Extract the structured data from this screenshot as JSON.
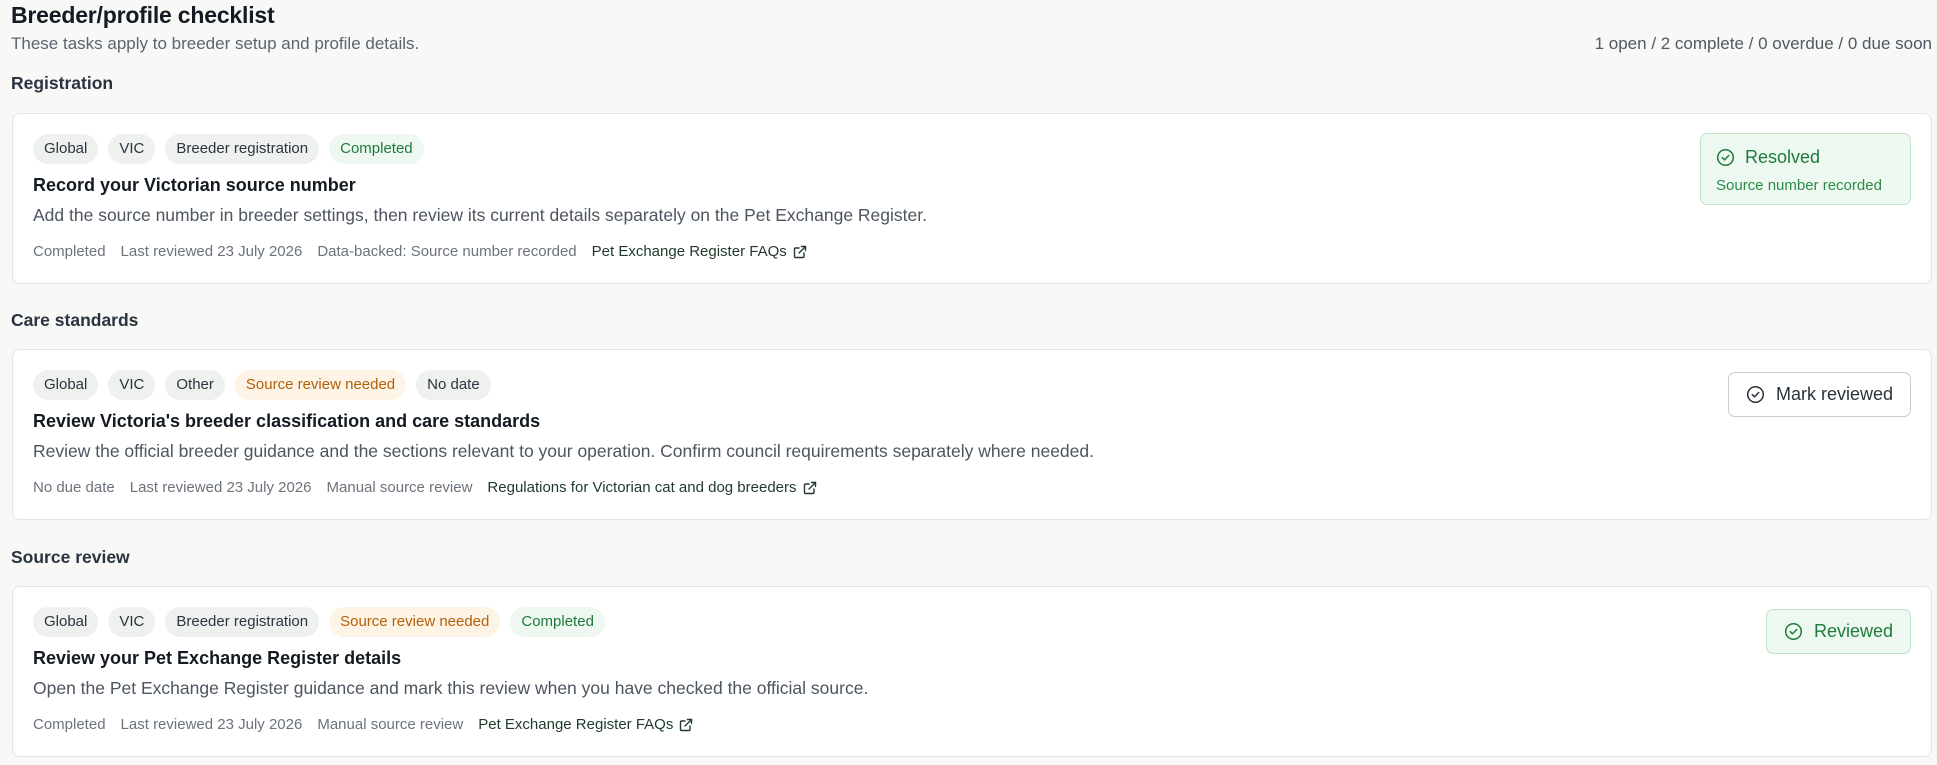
{
  "header": {
    "title": "Breeder/profile checklist",
    "subtitle": "These tasks apply to breeder setup and profile details.",
    "summary": "1 open / 2 complete / 0 overdue / 0 due soon"
  },
  "sections": [
    {
      "title": "Registration",
      "card": {
        "tags": [
          {
            "label": "Global",
            "tone": "neutral"
          },
          {
            "label": "VIC",
            "tone": "neutral"
          },
          {
            "label": "Breeder registration",
            "tone": "neutral"
          },
          {
            "label": "Completed",
            "tone": "green"
          }
        ],
        "title": "Record your Victorian source number",
        "description": "Add the source number in breeder settings, then review its current details separately on the Pet Exchange Register.",
        "meta": {
          "status": "Completed",
          "reviewed": "Last reviewed 23 July 2026",
          "source": "Data-backed: Source number recorded",
          "link": "Pet Exchange Register FAQs"
        },
        "status_box": {
          "label": "Resolved",
          "sub": "Source number recorded",
          "icon": "check-circle-icon"
        }
      }
    },
    {
      "title": "Care standards",
      "card": {
        "tags": [
          {
            "label": "Global",
            "tone": "neutral"
          },
          {
            "label": "VIC",
            "tone": "neutral"
          },
          {
            "label": "Other",
            "tone": "neutral"
          },
          {
            "label": "Source review needed",
            "tone": "amber"
          },
          {
            "label": "No date",
            "tone": "neutral"
          }
        ],
        "title": "Review Victoria's breeder classification and care standards",
        "description": "Review the official breeder guidance and the sections relevant to your operation. Confirm council requirements separately where needed.",
        "meta": {
          "status": "No due date",
          "reviewed": "Last reviewed 23 July 2026",
          "source": "Manual source review",
          "link": "Regulations for Victorian cat and dog breeders"
        },
        "action": {
          "label": "Mark reviewed",
          "icon": "check-circle-icon"
        }
      }
    },
    {
      "title": "Source review",
      "card": {
        "tags": [
          {
            "label": "Global",
            "tone": "neutral"
          },
          {
            "label": "VIC",
            "tone": "neutral"
          },
          {
            "label": "Breeder registration",
            "tone": "neutral"
          },
          {
            "label": "Source review needed",
            "tone": "amber"
          },
          {
            "label": "Completed",
            "tone": "green"
          }
        ],
        "title": "Review your Pet Exchange Register details",
        "description": "Open the Pet Exchange Register guidance and mark this review when you have checked the official source.",
        "meta": {
          "status": "Completed",
          "reviewed": "Last reviewed 23 July 2026",
          "source": "Manual source review",
          "link": "Pet Exchange Register FAQs"
        },
        "action": {
          "label": "Reviewed",
          "icon": "check-circle-icon"
        }
      }
    }
  ],
  "colors": {
    "accent_green": "#1f7a3c",
    "green_bg": "#edf8f0",
    "amber_text": "#b35f0c",
    "amber_bg": "#fdf4e5"
  }
}
